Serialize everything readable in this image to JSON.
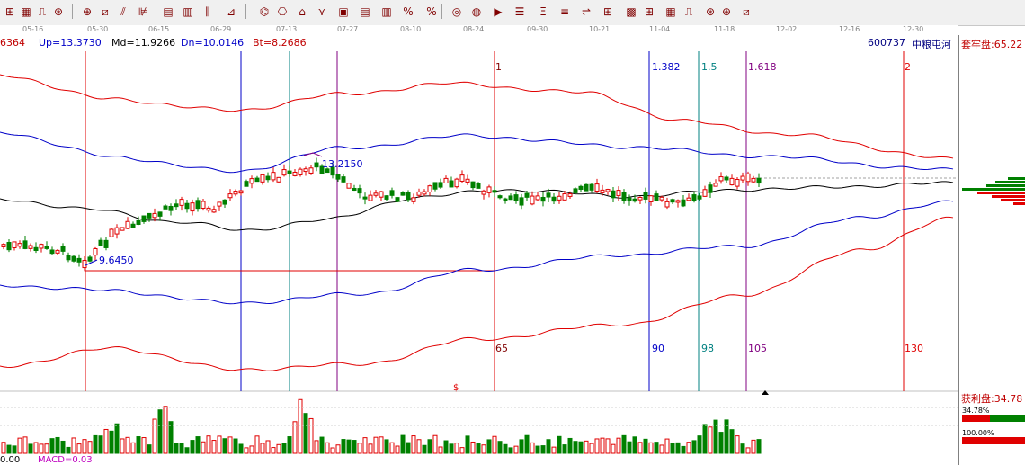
{
  "toolbar": {
    "icons": [
      "period-icon",
      "grid-icon",
      "draw-icon",
      "gann-fan-icon",
      "gann-square-icon",
      "diagonal-icon",
      "parallel-line-icon",
      "channel-icon",
      "grid-box-icon",
      "divider-icon",
      "text-icon",
      "fibonacci-fan-icon",
      "pattern-icon",
      "elliott-icon",
      "gann-grid-icon",
      "wave-icon",
      "box-icon",
      "box-grid-icon",
      "ruler-icon",
      "percent-icon",
      "percent-box-icon",
      "coin-icon",
      "coin-box-icon",
      "arrow-icon",
      "stack-icon",
      "price-icon",
      "price-line-icon",
      "price-step-icon",
      "price-grid-icon",
      "price-box-icon"
    ],
    "glyphs": [
      "⊞",
      "▦",
      "⎍",
      "⊛",
      "⊕",
      "⧄",
      "⫽",
      "⊯",
      "▤",
      "▥",
      "⫼",
      "⊿",
      "⌬",
      "⎔",
      "⌂",
      "⋎",
      "▣",
      "▤",
      "▥",
      "%",
      "%",
      "◎",
      "◍",
      "▶",
      "☰",
      "Ξ",
      "≡",
      "⇌",
      "⊞",
      "▩"
    ]
  },
  "dates": [
    "05-16",
    "05-30",
    "06-15",
    "06-29",
    "07-13",
    "07-27",
    "08-10",
    "08-24",
    "09-30",
    "10-21",
    "11-04",
    "11-18",
    "12-02",
    "12-16",
    "12-30"
  ],
  "info": {
    "partial": "6364",
    "up": "Up=13.3730",
    "md": "Md=11.9266",
    "dn": "Dn=10.0146",
    "bt": "Bt=8.2686",
    "code": "600737",
    "name": "中粮屯河"
  },
  "markers": {
    "high": "13.2150",
    "low": "9.6450",
    "gann": [
      "1",
      "1.382",
      "1.5",
      "1.618",
      "2"
    ],
    "days": [
      "65",
      "90",
      "98",
      "105",
      "130"
    ],
    "dollar": "$"
  },
  "right_panel": {
    "top_label": "套牢盘:65.22",
    "profit_label": "获利盘:34.78",
    "pct_a": "34.78%",
    "pct_b": "100.00%"
  },
  "bottom": {
    "left": "0.00",
    "macd": "MACD=0.03"
  },
  "colors": {
    "up": "#e00000",
    "down": "#008000",
    "blue": "#0000c8",
    "purple": "#800080",
    "teal": "#008080",
    "maroon": "#800000"
  }
}
